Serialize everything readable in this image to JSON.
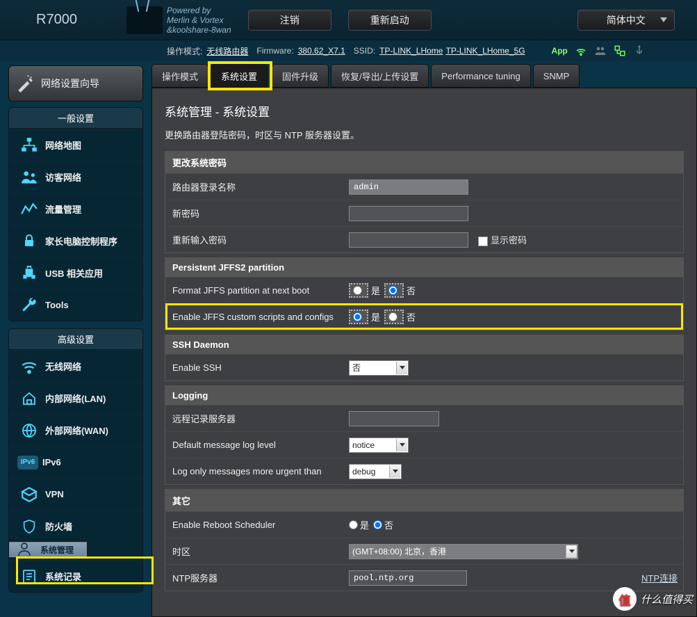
{
  "header": {
    "brand": "R7000",
    "powered_line1": "Powered by",
    "powered_line2": "Merlin & Vortex",
    "powered_line3": "&koolshare-8wan",
    "logout": "注销",
    "reboot": "重新启动",
    "lang": "简体中文"
  },
  "status": {
    "mode_lbl": "操作模式:",
    "mode": "无线路由器",
    "fw_lbl": "Firmware:",
    "fw": "380.62_X7.1",
    "ssid_lbl": "SSID:",
    "ssid1": "TP-LINK_LHome",
    "ssid2": "TP-LINK_LHome_5G",
    "app": "App"
  },
  "wizard": "网络设置向导",
  "panel_general": "一般设置",
  "menu_general": [
    "网络地图",
    "访客网络",
    "流量管理",
    "家长电脑控制程序",
    "USB 相关应用",
    "Tools"
  ],
  "panel_advanced": "高级设置",
  "menu_advanced": [
    "无线网络",
    "内部网络(LAN)",
    "外部网络(WAN)",
    "IPv6",
    "VPN",
    "防火墙",
    "系统管理",
    "系统记录"
  ],
  "tabs": [
    "操作模式",
    "系统设置",
    "固件升级",
    "恢复/导出/上传设置",
    "Performance tuning",
    "SNMP"
  ],
  "page": {
    "title": "系统管理 - 系统设置",
    "desc": "更换路由器登陆密码，时区与 NTP 服务器设置。"
  },
  "sect_pw": {
    "h": "更改系统密码",
    "login_lbl": "路由器登录名称",
    "login_val": "admin",
    "newpw_lbl": "新密码",
    "retype_lbl": "重新输入密码",
    "show_pw": "显示密码"
  },
  "sect_jffs": {
    "h": "Persistent JFFS2 partition",
    "format_lbl": "Format JFFS partition at next boot",
    "enable_lbl": "Enable JFFS custom scripts and configs",
    "yes": "是",
    "no": "否"
  },
  "sect_ssh": {
    "h": "SSH Daemon",
    "enable_lbl": "Enable SSH",
    "enable_val": "否"
  },
  "sect_log": {
    "h": "Logging",
    "remote_lbl": "远程记录服务器",
    "level_lbl": "Default message log level",
    "level_val": "notice",
    "urgent_lbl": "Log only messages more urgent than",
    "urgent_val": "debug"
  },
  "sect_misc": {
    "h": "其它",
    "reboot_lbl": "Enable Reboot Scheduler",
    "yes": "是",
    "no": "否",
    "tz_lbl": "时区",
    "tz_val": "(GMT+08:00) 北京，香港",
    "ntp_lbl": "NTP服务器",
    "ntp_val": "pool.ntp.org",
    "ntp_link": "NTP连接"
  },
  "watermark": "什么值得买"
}
